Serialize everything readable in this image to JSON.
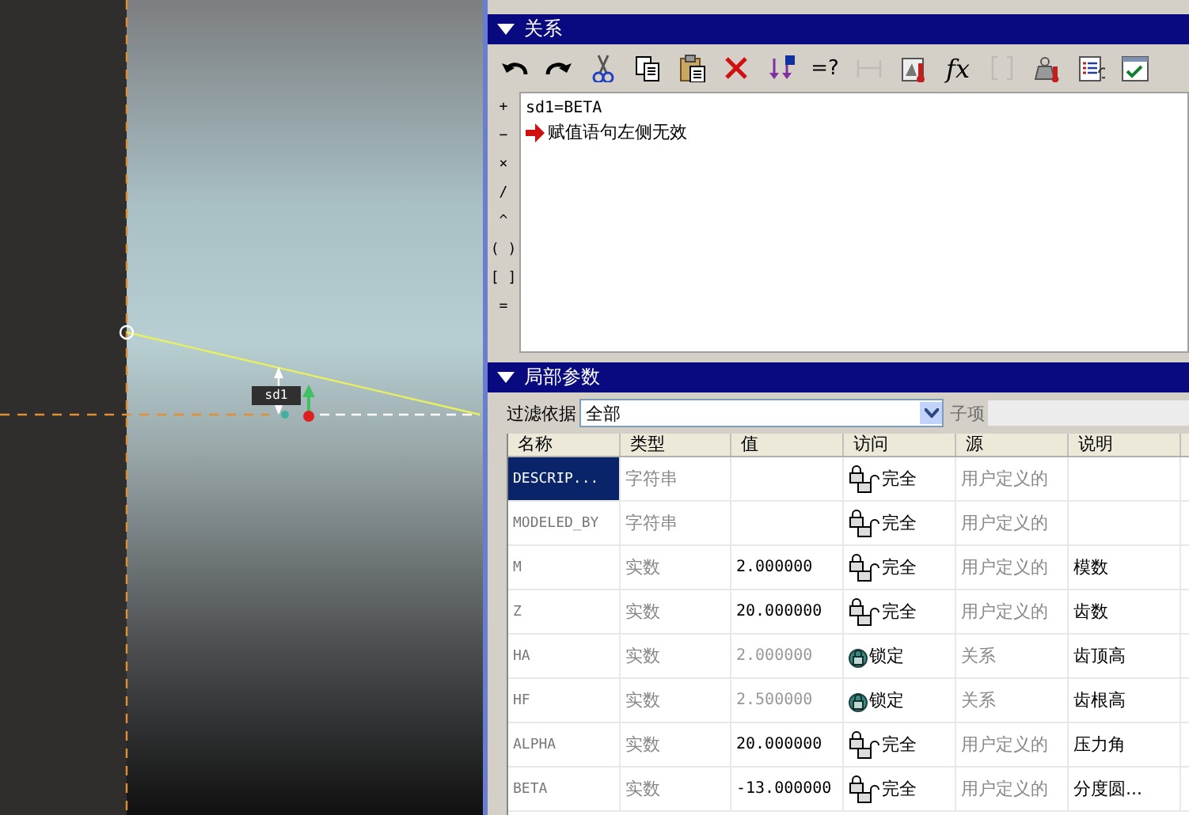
{
  "sketch": {
    "dimension_label": "sd1"
  },
  "relations": {
    "title": "关系",
    "expanded": true,
    "toolbar": [
      {
        "kind": "undo",
        "disabled": false
      },
      {
        "kind": "redo",
        "disabled": false
      },
      {
        "kind": "cut",
        "disabled": false
      },
      {
        "kind": "copy",
        "disabled": false
      },
      {
        "kind": "paste",
        "disabled": false
      },
      {
        "kind": "delete",
        "disabled": false
      },
      {
        "kind": "units",
        "disabled": false
      },
      {
        "kind": "text",
        "label": "=?",
        "disabled": false
      },
      {
        "kind": "dimension",
        "disabled": true
      },
      {
        "kind": "thermometer",
        "disabled": false
      },
      {
        "kind": "text",
        "label": "fx",
        "disabled": false
      },
      {
        "kind": "brackets",
        "disabled": true
      },
      {
        "kind": "weight",
        "disabled": false
      },
      {
        "kind": "list",
        "disabled": false
      },
      {
        "kind": "check",
        "disabled": false
      }
    ],
    "operators": [
      "+",
      "−",
      "×",
      "/",
      "^",
      "( )",
      "[ ]",
      "="
    ],
    "lines": [
      {
        "kind": "code",
        "text": "sd1=BETA"
      },
      {
        "kind": "error",
        "text": "赋值语句左侧无效"
      }
    ]
  },
  "local_params": {
    "title": "局部参数",
    "expanded": true,
    "filter": {
      "label": "过滤依据",
      "value": "全部",
      "sub_label": "子项"
    },
    "columns": [
      "名称",
      "类型",
      "值",
      "访问",
      "源",
      "说明"
    ],
    "rows": [
      {
        "name": "DESCRIP...",
        "type": "字符串",
        "value": "",
        "access": "完全",
        "source": "用户定义的",
        "note": "",
        "selected": true,
        "locked": false
      },
      {
        "name": "MODELED_BY",
        "type": "字符串",
        "value": "",
        "access": "完全",
        "source": "用户定义的",
        "note": "",
        "selected": false,
        "locked": false
      },
      {
        "name": "M",
        "type": "实数",
        "value": "2.000000",
        "access": "完全",
        "source": "用户定义的",
        "note": "模数",
        "selected": false,
        "locked": false
      },
      {
        "name": "Z",
        "type": "实数",
        "value": "20.000000",
        "access": "完全",
        "source": "用户定义的",
        "note": "齿数",
        "selected": false,
        "locked": false
      },
      {
        "name": "HA",
        "type": "实数",
        "value": "2.000000",
        "access": "锁定",
        "source": "关系",
        "note": "齿顶高",
        "selected": false,
        "locked": true
      },
      {
        "name": "HF",
        "type": "实数",
        "value": "2.500000",
        "access": "锁定",
        "source": "关系",
        "note": "齿根高",
        "selected": false,
        "locked": true
      },
      {
        "name": "ALPHA",
        "type": "实数",
        "value": "20.000000",
        "access": "完全",
        "source": "用户定义的",
        "note": "压力角",
        "selected": false,
        "locked": false
      },
      {
        "name": "BETA",
        "type": "实数",
        "value": "-13.000000",
        "access": "完全",
        "source": "用户定义的",
        "note": "分度圆...",
        "selected": false,
        "locked": false
      }
    ]
  }
}
